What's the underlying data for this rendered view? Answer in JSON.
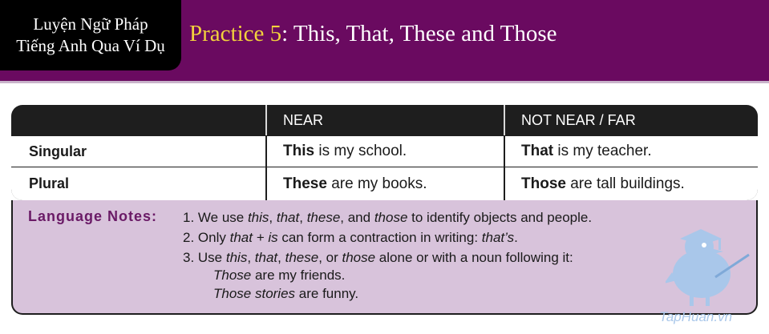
{
  "header": {
    "brand_line1": "Luyện Ngữ Pháp",
    "brand_line2": "Tiếng Anh Qua Ví Dụ",
    "title_accent": "Practice 5",
    "title_rest": ": This, That, These and Those"
  },
  "table": {
    "columns": [
      "",
      "NEAR",
      "NOT NEAR / FAR"
    ],
    "rows": [
      {
        "label": "Singular",
        "near_kw": "This",
        "near_rest": " is my school.",
        "far_kw": "That",
        "far_rest": " is my teacher."
      },
      {
        "label": "Plural",
        "near_kw": "These",
        "near_rest": " are my books.",
        "far_kw": "Those",
        "far_rest": " are tall buildings."
      }
    ]
  },
  "notes": {
    "title": "Language Notes:",
    "note1": {
      "a": "1. We use ",
      "w1": "this",
      "b": ", ",
      "w2": "that",
      "c": ", ",
      "w3": "these",
      "d": ", and ",
      "w4": "those",
      "e": " to identify objects and people."
    },
    "note2": {
      "a": "2. Only ",
      "w1": "that + is",
      "b": " can form a contraction in writing: ",
      "w2": "that’s",
      "c": "."
    },
    "note3": {
      "a": "3. Use ",
      "w1": "this",
      "b": ", ",
      "w2": "that",
      "c": ", ",
      "w3": "these",
      "d": ", or ",
      "w4": "those",
      "e": " alone or with a noun following it:"
    },
    "example1": {
      "w": "Those",
      "rest": " are my friends."
    },
    "example2": {
      "w": "Those stories",
      "rest": " are funny."
    }
  },
  "watermark": {
    "text": "TapHuan.vn",
    "icon": "bird-mascot-icon",
    "color": "#a9c7ea"
  },
  "colors": {
    "banner": "#6a0a60",
    "accent": "#f2d23c",
    "notes_bg": "#d8c3db",
    "notes_title": "#6a1a66"
  }
}
